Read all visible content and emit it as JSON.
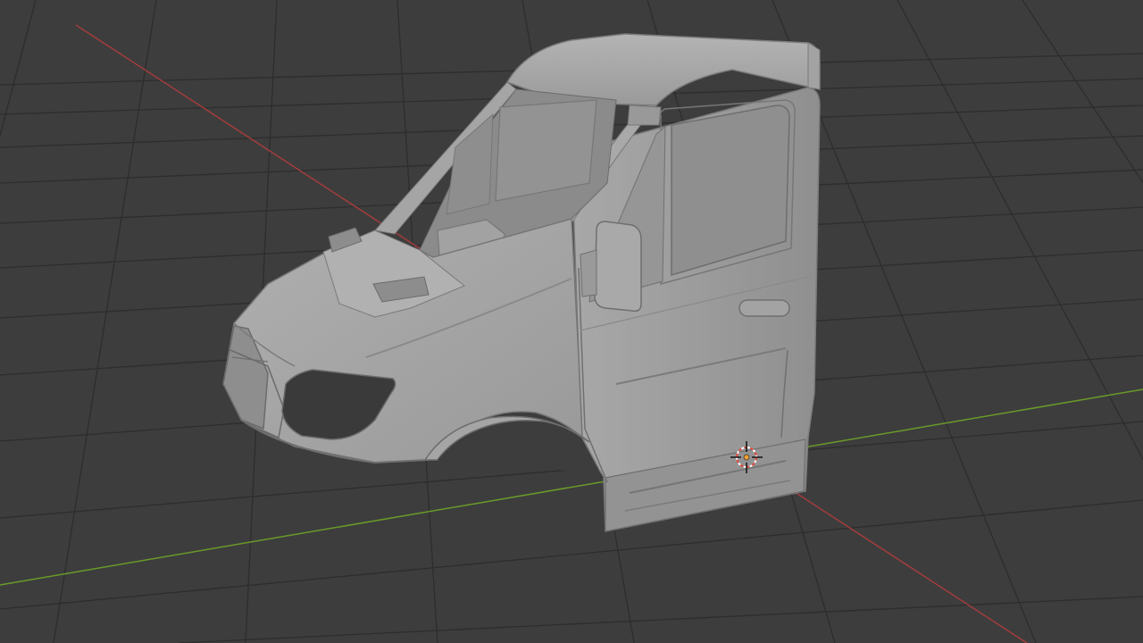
{
  "viewport": {
    "background": "#3d3d3d",
    "grid_color": "#2c2c2c",
    "x_axis_color": "#a33c3c",
    "y_axis_color": "#6a9a2a",
    "mesh_color": "#9e9e9e"
  },
  "scene": {
    "object": "van-cab-mesh",
    "cursor_icon": "3d-cursor-icon"
  }
}
